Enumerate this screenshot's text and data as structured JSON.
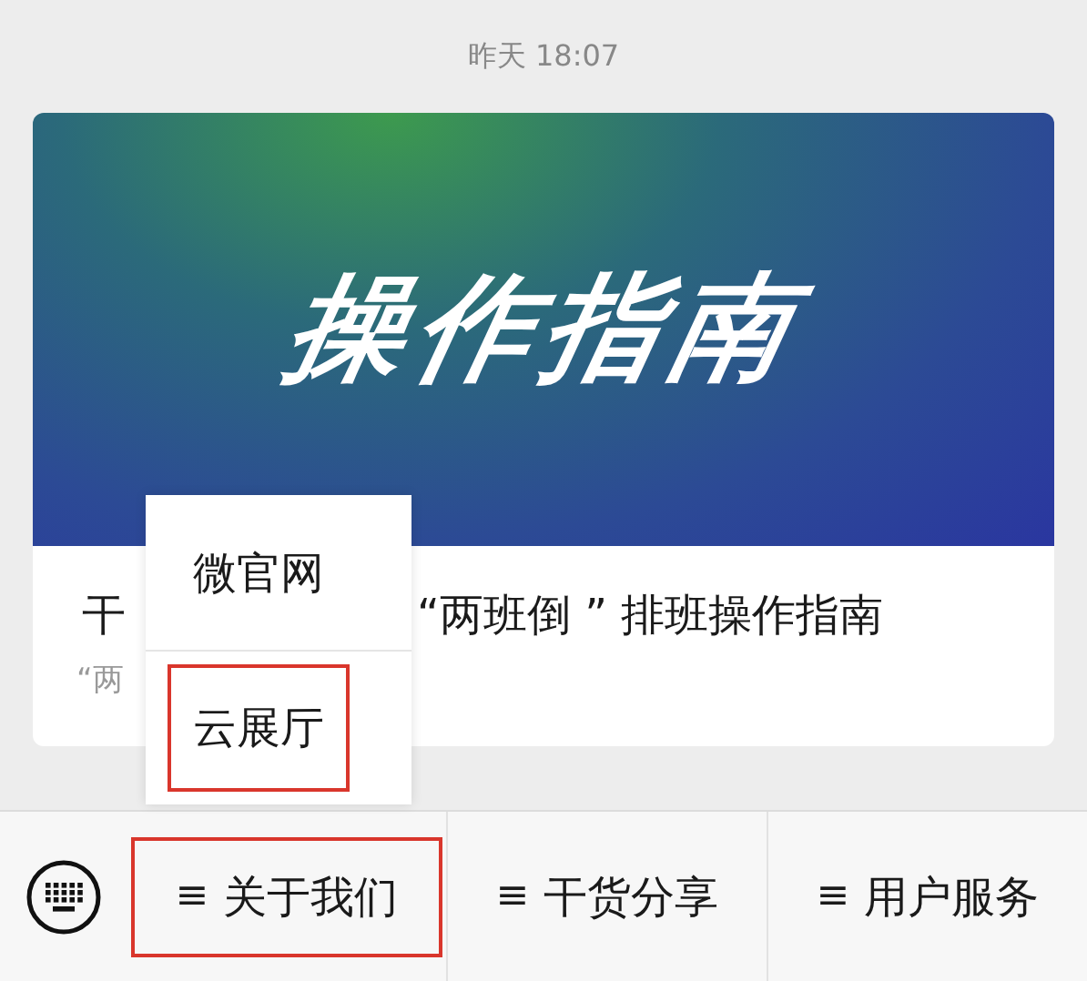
{
  "timestamp": "昨天 18:07",
  "article": {
    "cover_text": "操作指南",
    "title_start": "干",
    "title_end": "“两班倒 ” 排班操作指南",
    "summary": "“两"
  },
  "popup_menu": {
    "items": [
      {
        "label": "微官网",
        "selected": false
      },
      {
        "label": "云展厅",
        "selected": true
      }
    ]
  },
  "bottom_menu": {
    "items": [
      {
        "icon": "≡",
        "label": "关于我们",
        "selected": true
      },
      {
        "icon": "≡",
        "label": "干货分享",
        "selected": false
      },
      {
        "icon": "≡",
        "label": "用户服务",
        "selected": false
      }
    ]
  }
}
